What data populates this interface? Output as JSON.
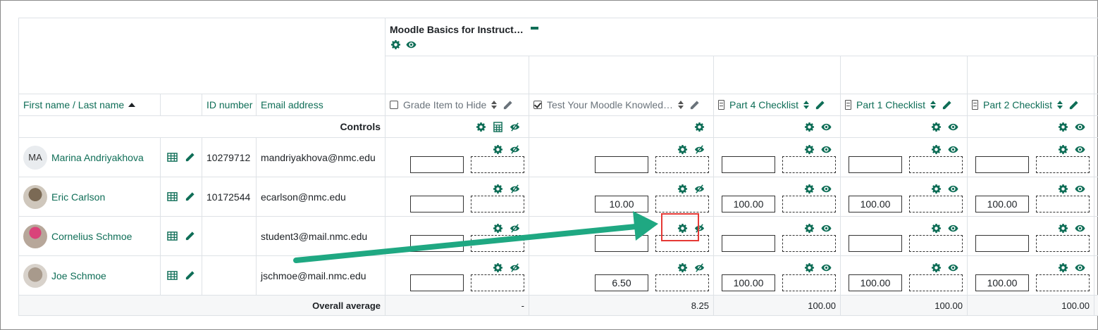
{
  "category": {
    "title": "Moodle Basics for Instruct…"
  },
  "headers": {
    "name": "First name / Last name",
    "id": "ID number",
    "email": "Email address"
  },
  "items": [
    {
      "label": "Grade Item to Hide",
      "style": "muted",
      "icon": "checkbox-icon"
    },
    {
      "label": "Test Your Moodle Knowled…",
      "style": "muted",
      "icon": "checked-checkbox-icon"
    },
    {
      "label": "Part 4 Checklist",
      "style": "green",
      "icon": "checklist-icon"
    },
    {
      "label": "Part 1 Checklist",
      "style": "green",
      "icon": "checklist-icon"
    },
    {
      "label": "Part 2 Checklist",
      "style": "green",
      "icon": "checklist-icon"
    }
  ],
  "controls_label": "Controls",
  "students": [
    {
      "initials": "MA",
      "name": "Marina Andriyakhova",
      "id": "10279712",
      "email": "mandriyakhova@nmc.edu",
      "grades": [
        "",
        "",
        "",
        "",
        ""
      ]
    },
    {
      "initials": "",
      "name": "Eric Carlson",
      "id": "10172544",
      "email": "ecarlson@nmc.edu",
      "grades": [
        "",
        "10.00",
        "100.00",
        "100.00",
        "100.00"
      ]
    },
    {
      "initials": "",
      "name": "Cornelius Schmoe",
      "id": "",
      "email": "student3@mail.nmc.edu",
      "grades": [
        "",
        "",
        "",
        "",
        ""
      ]
    },
    {
      "initials": "",
      "name": "Joe Schmoe",
      "id": "",
      "email": "jschmoe@mail.nmc.edu",
      "grades": [
        "",
        "6.50",
        "100.00",
        "100.00",
        "100.00"
      ]
    }
  ],
  "overall": {
    "label": "Overall average",
    "values": [
      "-",
      "8.25",
      "100.00",
      "100.00",
      "100.00"
    ]
  },
  "colors": {
    "accent": "#0f6e57",
    "arrow": "#1fa882",
    "highlight": "#e53935"
  }
}
